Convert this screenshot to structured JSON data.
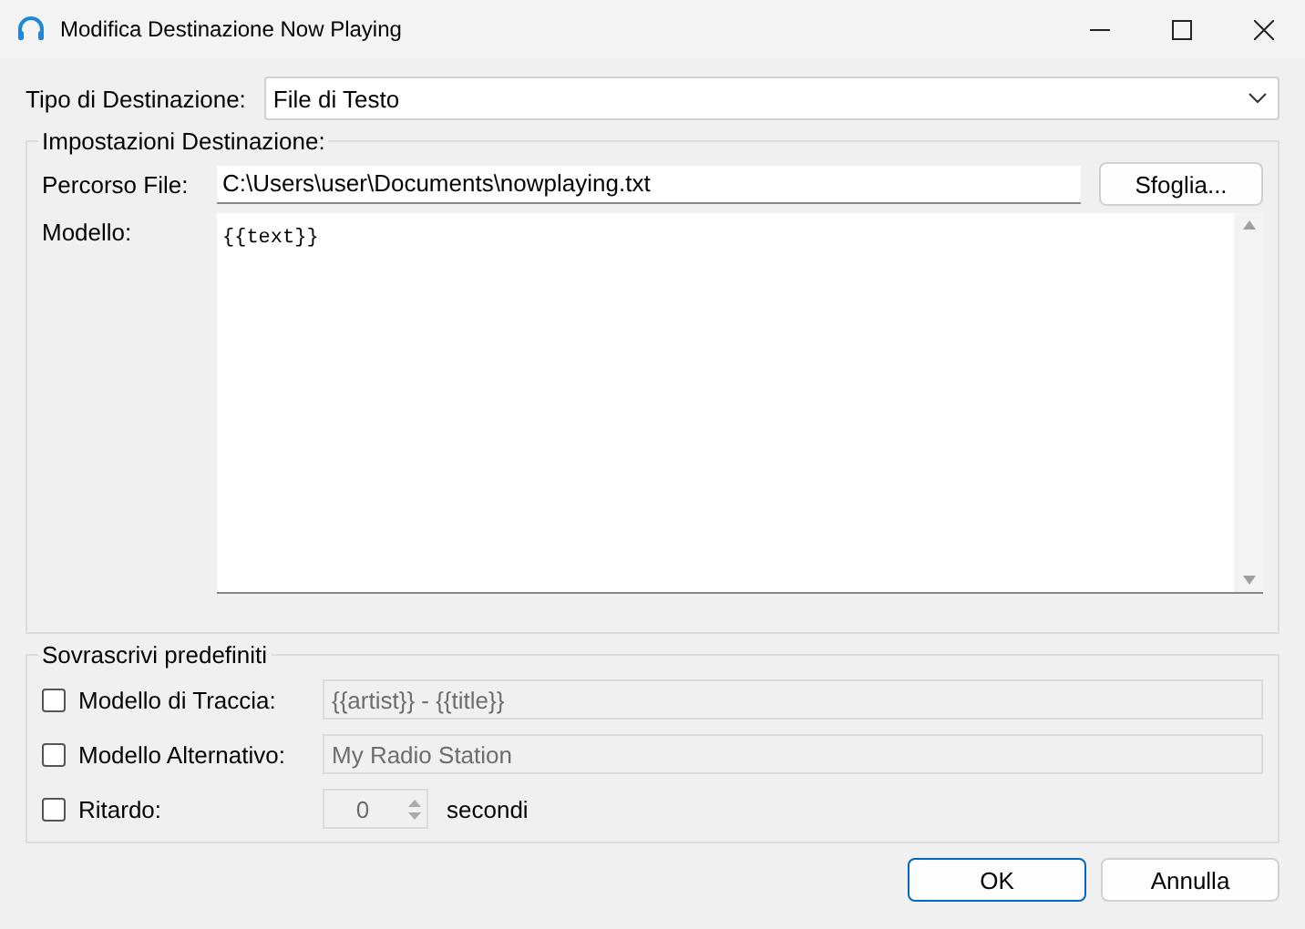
{
  "window": {
    "title": "Modifica Destinazione Now Playing"
  },
  "destination_type": {
    "label": "Tipo di Destinazione:",
    "value": "File di Testo"
  },
  "settings": {
    "title": "Impostazioni Destinazione:",
    "path_label": "Percorso File:",
    "path_value": "C:\\Users\\user\\Documents\\nowplaying.txt",
    "browse_button": "Sfoglia...",
    "template_label": "Modello:",
    "template_value": "{{text}}"
  },
  "overrides": {
    "title": "Sovrascrivi predefiniti",
    "rows": [
      {
        "kind": "text",
        "label": "Modello di Traccia:",
        "checked": false,
        "disabled": true,
        "value": "{{artist}} - {{title}}"
      },
      {
        "kind": "text",
        "label": "Modello Alternativo:",
        "checked": false,
        "disabled": true,
        "value": "My Radio Station"
      },
      {
        "kind": "spin",
        "label": "Ritardo:",
        "checked": false,
        "disabled": true,
        "value": "0",
        "unit": "secondi"
      }
    ]
  },
  "buttons": [
    "OK",
    "Annulla"
  ]
}
